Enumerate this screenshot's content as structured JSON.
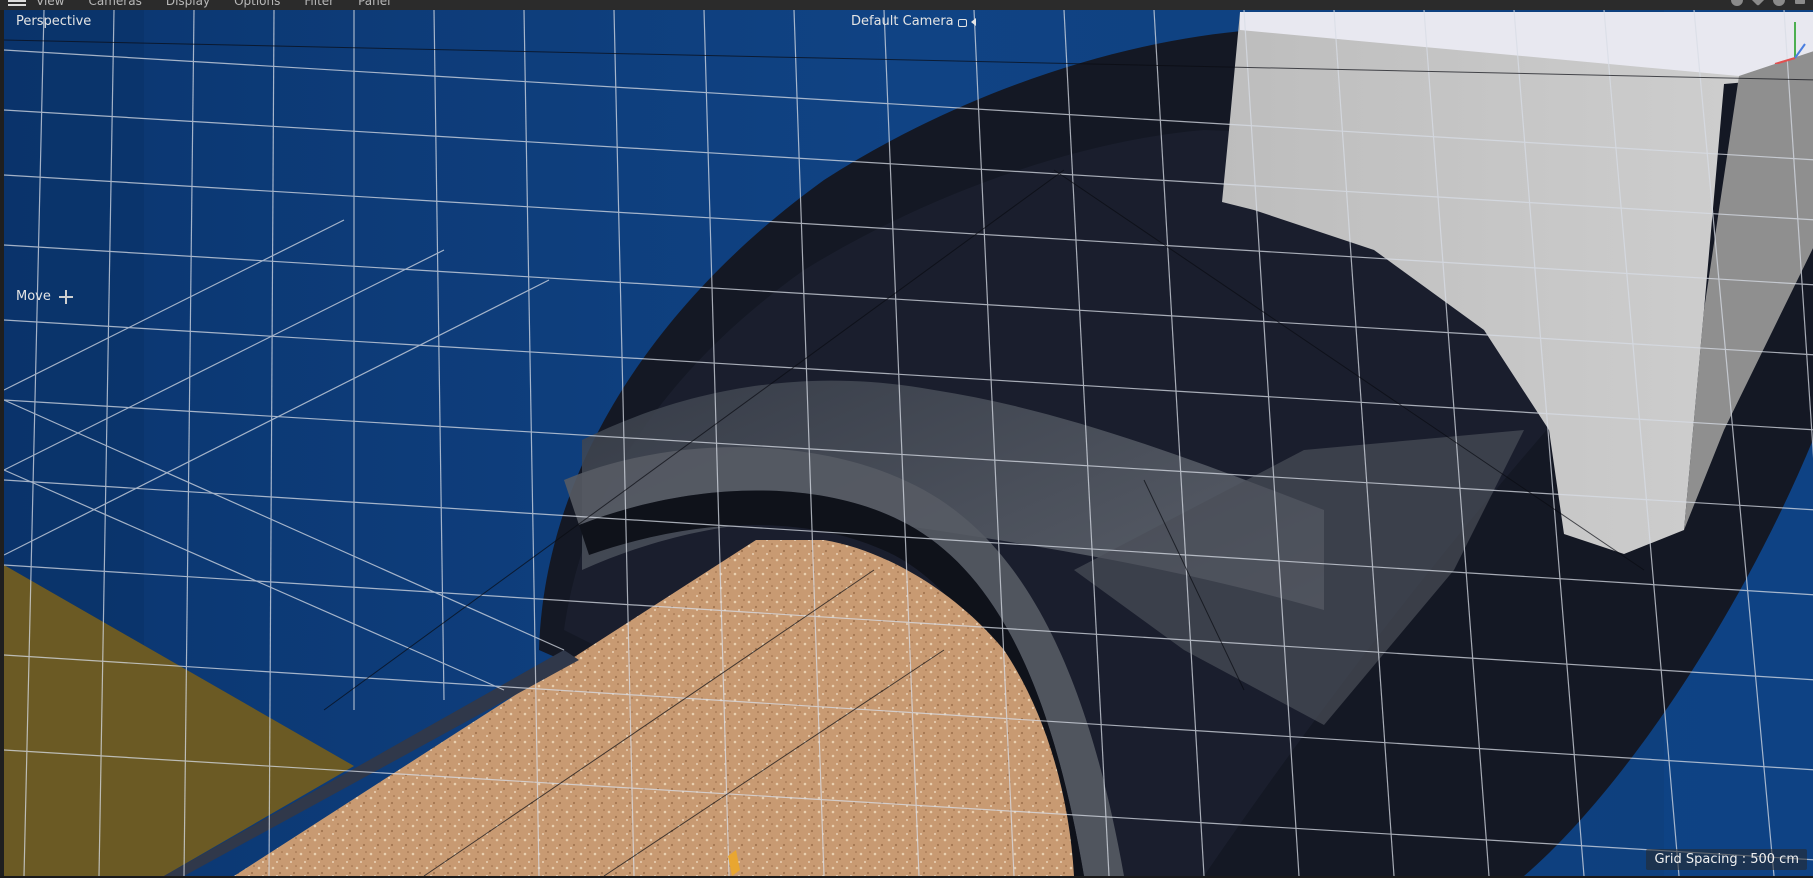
{
  "menu": {
    "items": [
      "View",
      "Cameras",
      "Display",
      "Options",
      "Filter",
      "Panel"
    ]
  },
  "viewport": {
    "name": "Perspective",
    "camera": "Default Camera",
    "active_tool": "Move",
    "grid_spacing": "Grid Spacing : 500 cm"
  },
  "colors": {
    "background_wall": "#0e3f7c",
    "dark_object": "#141824",
    "floor_texture": "#c89a72",
    "white_block": "#c8c8c8",
    "ground_yellow": "#6b5a24",
    "grid_line": "#d8dde6"
  },
  "icons": {
    "menu": "hamburger-icon",
    "camera_lock": "lock-icon",
    "camera_audio": "speaker-icon",
    "tool": "move-icon",
    "axis": "axis-gizmo-icon"
  }
}
